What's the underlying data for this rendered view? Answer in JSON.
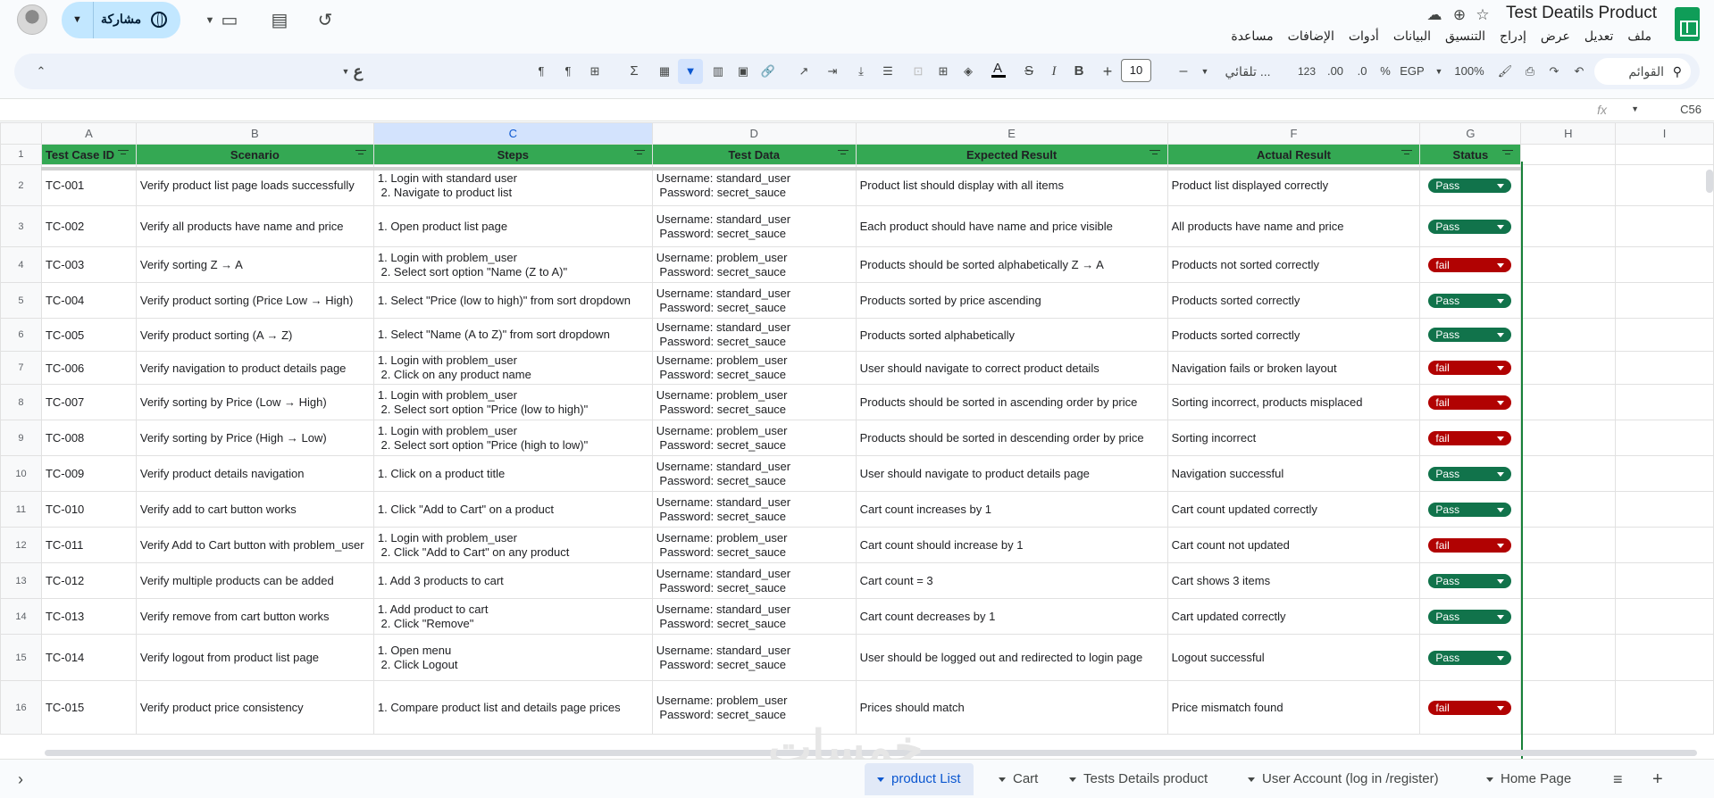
{
  "app": {
    "doc_title": "Test Deatils Product",
    "menu": [
      "ملف",
      "تعديل",
      "عرض",
      "إدراج",
      "التنسيق",
      "البيانات",
      "أدوات",
      "الإضافات",
      "مساعدة"
    ],
    "share_label": "مشاركة"
  },
  "toolbar": {
    "search_menus": "القوائم",
    "zoom": "100%",
    "currency": "EGP",
    "percent": "%",
    "dec_decrease": ".0",
    "dec_increase": ".00",
    "number_format": "123",
    "font": "تلقائي ...",
    "font_size": "10",
    "minus": "–",
    "plus": "+",
    "bold": "B",
    "italic": "I",
    "strike": "S",
    "text_color_label": "A",
    "sigma": "Σ",
    "rtl_char": "ع"
  },
  "formula_bar": {
    "cell_ref": "C56",
    "fx_label": "fx",
    "value": ""
  },
  "grid": {
    "column_letters": [
      "A",
      "B",
      "C",
      "D",
      "E",
      "F",
      "G",
      "H",
      "I"
    ],
    "headers": [
      "Test Case ID",
      "Scenario",
      "Steps",
      "Test Data",
      "Expected Result",
      "Actual Result",
      "Status"
    ],
    "rows": [
      {
        "n": "2",
        "id": "TC-001",
        "scenario": "Verify product list page loads successfully",
        "steps": "1. Login with standard user\n 2. Navigate to product list",
        "data": "Username: standard_user\n Password: secret_sauce",
        "expected": "Product list should display with all items",
        "actual": "Product list displayed correctly",
        "status": "Pass"
      },
      {
        "n": "3",
        "id": "TC-002",
        "scenario": "Verify all products have name and price",
        "steps": "1. Open product list page",
        "data": "Username: standard_user\n Password: secret_sauce",
        "expected": "Each product should have name and price visible",
        "actual": "All products have name and price",
        "status": "Pass"
      },
      {
        "n": "4",
        "id": "TC-003",
        "scenario": " Verify sorting Z → A",
        "steps": "1. Login with problem_user\n 2. Select sort option \"Name (Z to A)\"",
        "data": "Username: problem_user\n Password: secret_sauce",
        "expected": "Products should be sorted alphabetically Z → A",
        "actual": "Products not sorted correctly",
        "status": "fail"
      },
      {
        "n": "5",
        "id": "TC-004",
        "scenario": "Verify product sorting (Price Low → High)",
        "steps": "1. Select \"Price (low to high)\" from sort dropdown",
        "data": "Username: standard_user\n Password: secret_sauce",
        "expected": "Products sorted by price ascending",
        "actual": "Products sorted correctly",
        "status": "Pass"
      },
      {
        "n": "6",
        "id": "TC-005",
        "scenario": "Verify product sorting (A → Z)",
        "steps": "1. Select \"Name (A to Z)\" from sort dropdown",
        "data": "Username: standard_user\n Password: secret_sauce",
        "expected": "Products sorted alphabetically",
        "actual": "Products sorted correctly",
        "status": "Pass"
      },
      {
        "n": "7",
        "id": "TC-006",
        "scenario": "Verify navigation to product details page",
        "steps": "1. Login with problem_user\n 2. Click on any product name",
        "data": "Username: problem_user\n Password: secret_sauce",
        "expected": "User should navigate to correct product details",
        "actual": "Navigation fails or broken layout",
        "status": "fail"
      },
      {
        "n": "8",
        "id": "TC-007",
        "scenario": " Verify sorting by Price (Low → High)",
        "steps": "1. Login with problem_user\n 2. Select sort option \"Price (low to high)\"",
        "data": "Username: problem_user\n Password: secret_sauce",
        "expected": "Products should be sorted in ascending order by price",
        "actual": "Sorting incorrect, products misplaced",
        "status": "fail"
      },
      {
        "n": "9",
        "id": "TC-008",
        "scenario": "Verify sorting by Price (High → Low)",
        "steps": "1. Login with problem_user\n 2. Select sort option \"Price (high to low)\"",
        "data": "Username: problem_user\n Password: secret_sauce",
        "expected": "Products should be sorted in descending order by price",
        "actual": "Sorting incorrect",
        "status": "fail"
      },
      {
        "n": "10",
        "id": "TC-009",
        "scenario": "Verify product details navigation",
        "steps": "1. Click on a product title",
        "data": "Username: standard_user\n Password: secret_sauce",
        "expected": "User should navigate to product details page",
        "actual": "Navigation successful",
        "status": "Pass"
      },
      {
        "n": "11",
        "id": "TC-010",
        "scenario": "Verify add to cart button works",
        "steps": "1. Click \"Add to Cart\" on a product",
        "data": "Username: standard_user\n Password: secret_sauce",
        "expected": "Cart count increases by 1",
        "actual": "Cart count updated correctly",
        "status": "Pass"
      },
      {
        "n": "12",
        "id": "TC-011",
        "scenario": "Verify Add to Cart button with problem_user",
        "steps": "1. Login with problem_user\n 2. Click \"Add to Cart\" on any product",
        "data": "Username: problem_user\n Password: secret_sauce",
        "expected": "Cart count should increase by 1",
        "actual": "Cart count not updated",
        "status": "fail"
      },
      {
        "n": "13",
        "id": "TC-012",
        "scenario": "Verify multiple products can be added",
        "steps": "1. Add 3 products to cart",
        "data": "Username: standard_user\n Password: secret_sauce",
        "expected": "Cart count = 3",
        "actual": "Cart shows 3 items",
        "status": "Pass"
      },
      {
        "n": "14",
        "id": "TC-013",
        "scenario": "Verify remove from cart button works",
        "steps": "1. Add product to cart\n 2. Click \"Remove\"",
        "data": "Username: standard_user\n Password: secret_sauce",
        "expected": "Cart count decreases by 1",
        "actual": "Cart updated correctly",
        "status": "Pass"
      },
      {
        "n": "15",
        "id": "TC-014",
        "scenario": "Verify logout from product list page",
        "steps": "1. Open menu\n 2. Click Logout",
        "data": "Username: standard_user\n Password: secret_sauce",
        "expected": "User should be logged out and redirected to login page",
        "actual": "Logout successful",
        "status": "Pass"
      },
      {
        "n": "16",
        "id": "TC-015",
        "scenario": "Verify product price consistency",
        "steps": "1. Compare product list and details page prices",
        "data": "Username: problem_user\n Password: secret_sauce",
        "expected": "Prices should match",
        "actual": "Price mismatch found",
        "status": "fail"
      }
    ],
    "row1_number": "1"
  },
  "colors": {
    "header_green": "#34a853",
    "pass_green": "#11734b",
    "fail_red": "#b10202",
    "accent_blue": "#0b57d0"
  },
  "sheets": {
    "tabs": [
      "product List",
      "Cart",
      "Tests Details product",
      "User Account (log in /register)",
      "Home Page"
    ],
    "active": "product List"
  }
}
